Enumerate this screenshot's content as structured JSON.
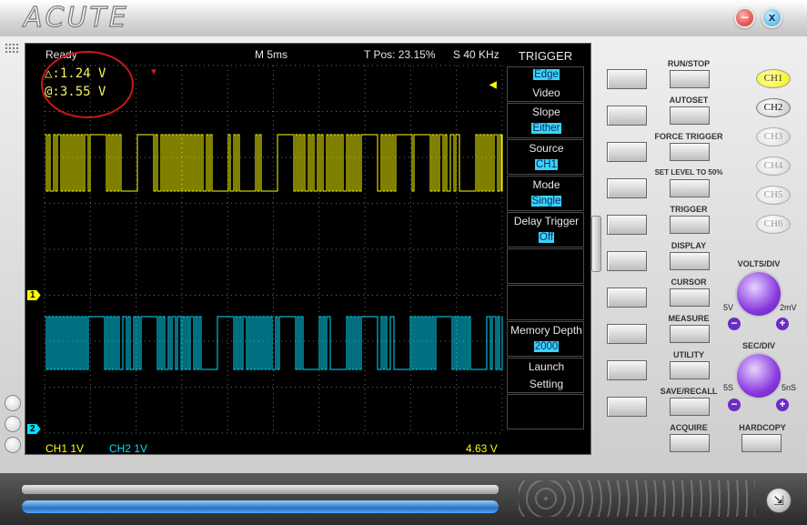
{
  "window": {
    "logo": "ACUTE",
    "minimize_icon": "minus-icon",
    "close_icon": "x-icon",
    "minimize_glyph": "−",
    "close_glyph": "x"
  },
  "status": {
    "state": "Ready",
    "timebase": "M 5ms",
    "trigger_position": "T Pos: 23.15%",
    "sample_rate": "S 40 KHz"
  },
  "readouts": {
    "delta": "△:1.24 V",
    "at": "@:3.55 V"
  },
  "channels": {
    "ch1_marker": "1",
    "ch2_marker": "2",
    "ch1_label": "CH1  1V",
    "ch2_label": "CH2  1V",
    "trigger_level": "4.63 V",
    "ch1_color": "#ffff00",
    "ch2_color": "#00e0ff"
  },
  "trigger_menu": {
    "title": "TRIGGER",
    "items": [
      {
        "lines": [
          "Edge",
          "Video"
        ],
        "highlight": [
          true,
          false
        ]
      },
      {
        "lines": [
          "Slope",
          "Either"
        ],
        "highlight": [
          false,
          true
        ]
      },
      {
        "lines": [
          "Source",
          "CH1"
        ],
        "highlight": [
          false,
          true
        ]
      },
      {
        "lines": [
          "Mode",
          "Single"
        ],
        "highlight": [
          false,
          true
        ]
      },
      {
        "lines": [
          "Delay Trigger",
          "Off"
        ],
        "highlight": [
          false,
          true
        ]
      },
      {
        "lines": [
          "",
          ""
        ],
        "highlight": [
          false,
          false
        ]
      },
      {
        "lines": [
          "",
          ""
        ],
        "highlight": [
          false,
          false
        ]
      },
      {
        "lines": [
          "Memory Depth",
          "2000"
        ],
        "highlight": [
          false,
          true
        ]
      },
      {
        "lines": [
          "Launch",
          "Setting"
        ],
        "highlight": [
          false,
          false
        ]
      },
      {
        "lines": [
          "",
          ""
        ],
        "highlight": [
          false,
          false
        ]
      }
    ]
  },
  "controls": {
    "run_stop": "RUN/STOP",
    "autoset": "AUTOSET",
    "force_trigger": "FORCE TRIGGER",
    "set_level": "SET LEVEL TO 50%",
    "trigger": "TRIGGER",
    "display": "DISPLAY",
    "cursor": "CURSOR",
    "measure": "MEASURE",
    "utility": "UTILITY",
    "save_recall": "SAVE/RECALL",
    "acquire": "ACQUIRE",
    "hardcopy": "HARDCOPY"
  },
  "channel_buttons": [
    "CH1",
    "CH2",
    "CH3",
    "CH4",
    "CH5",
    "CH6"
  ],
  "knobs": {
    "volts_div": {
      "title": "VOLTS/DIV",
      "left": "5V",
      "right": "2mV"
    },
    "sec_div": {
      "title": "SEC/DIV",
      "left": "5S",
      "right": "5nS"
    }
  },
  "colors": {
    "annotation": "#d01818",
    "menu_highlight": "#3ad3ff",
    "ch1_button": "#ffff33",
    "knob": "#8a3ae0"
  }
}
